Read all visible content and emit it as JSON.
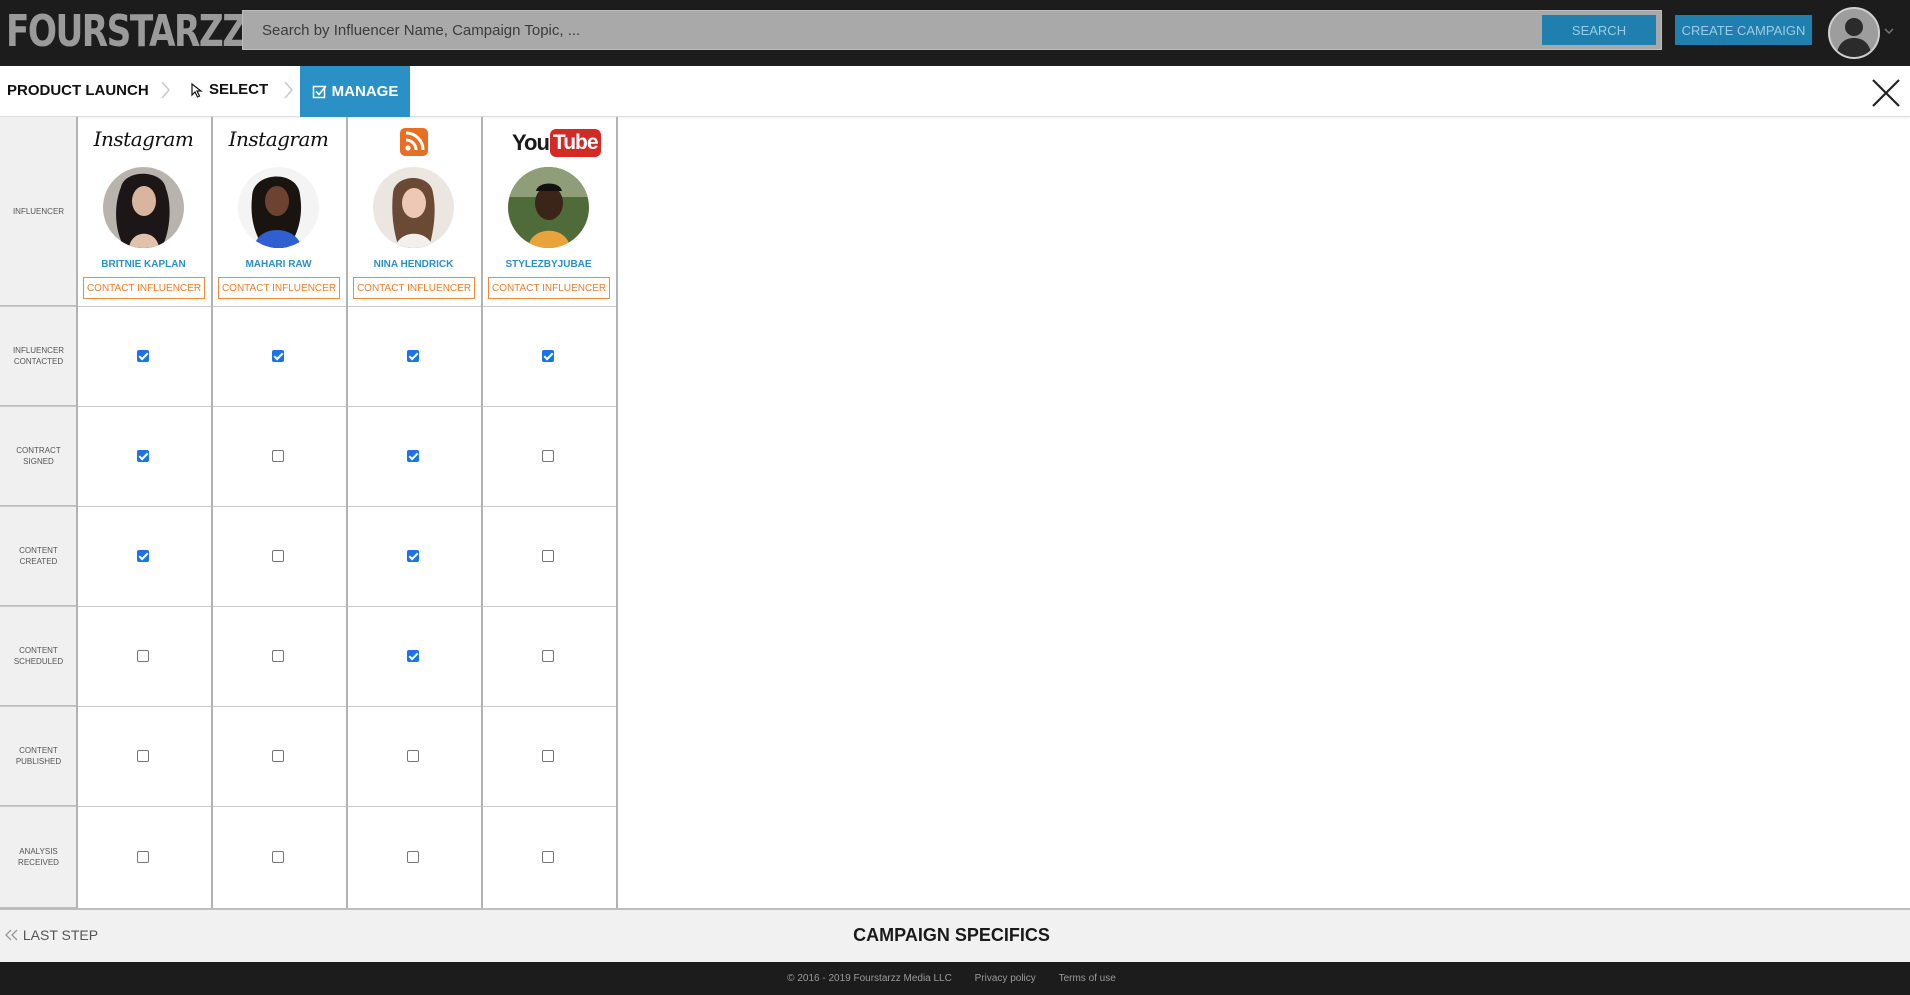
{
  "header": {
    "logo": "FOURSTARZZ",
    "search_placeholder": "Search by Influencer Name, Campaign Topic, ...",
    "search_label": "SEARCH",
    "create_label": "CREATE CAMPAIGN",
    "avatar_icon": "user-avatar-icon"
  },
  "breadcrumb": {
    "title": "PRODUCT LAUNCH",
    "steps": [
      {
        "label": "SELECT",
        "icon": "cursor-icon",
        "active": false
      },
      {
        "label": "MANAGE",
        "icon": "checkbox-icon",
        "active": true
      }
    ]
  },
  "rows": [
    {
      "label": "INFLUENCER"
    },
    {
      "label": "INFLUENCER CONTACTED"
    },
    {
      "label": "CONTRACT SIGNED"
    },
    {
      "label": "CONTENT CREATED"
    },
    {
      "label": "CONTENT SCHEDULED"
    },
    {
      "label": "CONTENT PUBLISHED"
    },
    {
      "label": "ANALYSIS RECEIVED"
    }
  ],
  "influencers": [
    {
      "name": "BRITNIE KAPLAN",
      "platform": "Instagram",
      "contact_label": "CONTACT INFLUENCER",
      "status": [
        true,
        true,
        true,
        false,
        false,
        false
      ]
    },
    {
      "name": "MAHARI RAW",
      "platform": "Instagram",
      "contact_label": "CONTACT INFLUENCER",
      "status": [
        true,
        false,
        false,
        false,
        false,
        false
      ]
    },
    {
      "name": "NINA HENDRICK",
      "platform": "rss-icon",
      "contact_label": "CONTACT INFLUENCER",
      "status": [
        true,
        true,
        true,
        true,
        false,
        false
      ]
    },
    {
      "name": "STYLEZBYJUBAE",
      "platform": "YouTube",
      "contact_label": "CONTACT INFLUENCER",
      "status": [
        true,
        false,
        false,
        false,
        false,
        false
      ]
    }
  ],
  "youtube": {
    "you": "You",
    "tube": "Tube"
  },
  "footer_nav": {
    "last_step": "LAST STEP",
    "next_step": "CAMPAIGN SPECIFICS"
  },
  "footer": {
    "copyright": "© 2016 - 2019 Fourstarzz Media LLC",
    "privacy": "Privacy policy",
    "terms": "Terms of use"
  },
  "colors": {
    "accent": "#2a90c6",
    "contact_orange": "#ef7d27",
    "dark_bar": "#1c1c1c"
  }
}
